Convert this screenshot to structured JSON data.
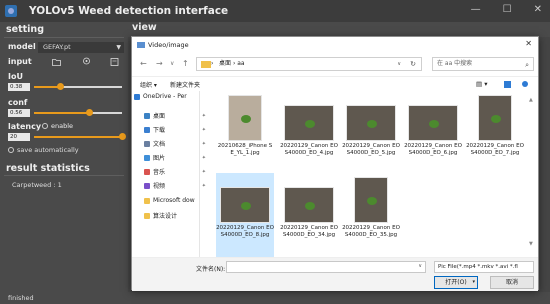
{
  "app": {
    "title": "YOLOv5 Weed detection interface",
    "window_controls": {
      "minimize": "—",
      "maximize": "☐",
      "close": "✕"
    }
  },
  "setting": {
    "heading": "setting",
    "model_label": "model",
    "model_value": "GEFAY.pt",
    "input_label": "input",
    "iou_label": "IoU",
    "iou_value": "0.38",
    "iou_level": 0.3,
    "conf_label": "conf",
    "conf_value": "0.56",
    "conf_level": 0.63,
    "latency_label": "latency",
    "latency_enable": "enable",
    "latency_value": "20",
    "latency_level": 1.0,
    "save_label": "save automatically"
  },
  "result": {
    "heading": "result statistics",
    "item": "Carpetweed : 1"
  },
  "view": {
    "heading": "view"
  },
  "status": {
    "text": "finished"
  },
  "dialog": {
    "title": "Video/image",
    "path": [
      "桌面",
      "aa"
    ],
    "search_placeholder": "在 aa 中搜索",
    "organize": "组织 ▾",
    "new_folder": "新建文件夹",
    "sidebar": [
      {
        "label": "OneDrive - Per",
        "color": "#2e7bd4"
      },
      {
        "label": "桌面",
        "color": "#3b82c4"
      },
      {
        "label": "下载",
        "color": "#3b7fd0"
      },
      {
        "label": "文档",
        "color": "#6a7fa0"
      },
      {
        "label": "图片",
        "color": "#3f8fd8"
      },
      {
        "label": "音乐",
        "color": "#d9534f"
      },
      {
        "label": "视频",
        "color": "#7a4fc9"
      },
      {
        "label": "Microsoft dow",
        "color": "#f0c14b"
      },
      {
        "label": "算法设计",
        "color": "#f0c14b"
      }
    ],
    "files": [
      {
        "name": "20210628_iPhone SE_YL_1.jpg",
        "selected": false
      },
      {
        "name": "20220129_Canon EOS4000D_EO_4.jpg",
        "selected": false
      },
      {
        "name": "20220129_Canon EOS4000D_EO_5.jpg",
        "selected": false
      },
      {
        "name": "20220129_Canon EOS4000D_EO_6.jpg",
        "selected": false
      },
      {
        "name": "20220129_Canon EOS4000D_EO_7.jpg",
        "selected": false
      },
      {
        "name": "20220129_Canon EOS4000D_EO_8.jpg",
        "selected": true
      },
      {
        "name": "20220129_Canon EOS4000D_EO_34.jpg",
        "selected": false
      },
      {
        "name": "20220129_Canon EOS4000D_EO_35.jpg",
        "selected": false
      }
    ],
    "filename_label": "文件名(N):",
    "filename_value": "",
    "filter_value": "Pic File(*.mp4 *.mkv *.avi *.fl",
    "open_label": "打开(O)",
    "cancel_label": "取消"
  },
  "colors": {
    "accent": "#e89a1c",
    "selection": "#cce8ff",
    "panel": "#4a4a4a"
  }
}
